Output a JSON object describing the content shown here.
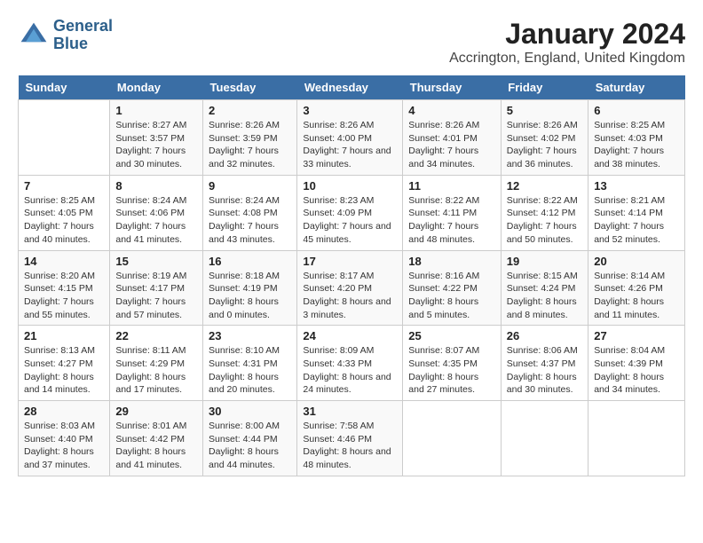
{
  "header": {
    "logo_line1": "General",
    "logo_line2": "Blue",
    "title": "January 2024",
    "subtitle": "Accrington, England, United Kingdom"
  },
  "calendar": {
    "days_of_week": [
      "Sunday",
      "Monday",
      "Tuesday",
      "Wednesday",
      "Thursday",
      "Friday",
      "Saturday"
    ],
    "weeks": [
      [
        {
          "day": "",
          "sunrise": "",
          "sunset": "",
          "daylight": ""
        },
        {
          "day": "1",
          "sunrise": "Sunrise: 8:27 AM",
          "sunset": "Sunset: 3:57 PM",
          "daylight": "Daylight: 7 hours and 30 minutes."
        },
        {
          "day": "2",
          "sunrise": "Sunrise: 8:26 AM",
          "sunset": "Sunset: 3:59 PM",
          "daylight": "Daylight: 7 hours and 32 minutes."
        },
        {
          "day": "3",
          "sunrise": "Sunrise: 8:26 AM",
          "sunset": "Sunset: 4:00 PM",
          "daylight": "Daylight: 7 hours and 33 minutes."
        },
        {
          "day": "4",
          "sunrise": "Sunrise: 8:26 AM",
          "sunset": "Sunset: 4:01 PM",
          "daylight": "Daylight: 7 hours and 34 minutes."
        },
        {
          "day": "5",
          "sunrise": "Sunrise: 8:26 AM",
          "sunset": "Sunset: 4:02 PM",
          "daylight": "Daylight: 7 hours and 36 minutes."
        },
        {
          "day": "6",
          "sunrise": "Sunrise: 8:25 AM",
          "sunset": "Sunset: 4:03 PM",
          "daylight": "Daylight: 7 hours and 38 minutes."
        }
      ],
      [
        {
          "day": "7",
          "sunrise": "Sunrise: 8:25 AM",
          "sunset": "Sunset: 4:05 PM",
          "daylight": "Daylight: 7 hours and 40 minutes."
        },
        {
          "day": "8",
          "sunrise": "Sunrise: 8:24 AM",
          "sunset": "Sunset: 4:06 PM",
          "daylight": "Daylight: 7 hours and 41 minutes."
        },
        {
          "day": "9",
          "sunrise": "Sunrise: 8:24 AM",
          "sunset": "Sunset: 4:08 PM",
          "daylight": "Daylight: 7 hours and 43 minutes."
        },
        {
          "day": "10",
          "sunrise": "Sunrise: 8:23 AM",
          "sunset": "Sunset: 4:09 PM",
          "daylight": "Daylight: 7 hours and 45 minutes."
        },
        {
          "day": "11",
          "sunrise": "Sunrise: 8:22 AM",
          "sunset": "Sunset: 4:11 PM",
          "daylight": "Daylight: 7 hours and 48 minutes."
        },
        {
          "day": "12",
          "sunrise": "Sunrise: 8:22 AM",
          "sunset": "Sunset: 4:12 PM",
          "daylight": "Daylight: 7 hours and 50 minutes."
        },
        {
          "day": "13",
          "sunrise": "Sunrise: 8:21 AM",
          "sunset": "Sunset: 4:14 PM",
          "daylight": "Daylight: 7 hours and 52 minutes."
        }
      ],
      [
        {
          "day": "14",
          "sunrise": "Sunrise: 8:20 AM",
          "sunset": "Sunset: 4:15 PM",
          "daylight": "Daylight: 7 hours and 55 minutes."
        },
        {
          "day": "15",
          "sunrise": "Sunrise: 8:19 AM",
          "sunset": "Sunset: 4:17 PM",
          "daylight": "Daylight: 7 hours and 57 minutes."
        },
        {
          "day": "16",
          "sunrise": "Sunrise: 8:18 AM",
          "sunset": "Sunset: 4:19 PM",
          "daylight": "Daylight: 8 hours and 0 minutes."
        },
        {
          "day": "17",
          "sunrise": "Sunrise: 8:17 AM",
          "sunset": "Sunset: 4:20 PM",
          "daylight": "Daylight: 8 hours and 3 minutes."
        },
        {
          "day": "18",
          "sunrise": "Sunrise: 8:16 AM",
          "sunset": "Sunset: 4:22 PM",
          "daylight": "Daylight: 8 hours and 5 minutes."
        },
        {
          "day": "19",
          "sunrise": "Sunrise: 8:15 AM",
          "sunset": "Sunset: 4:24 PM",
          "daylight": "Daylight: 8 hours and 8 minutes."
        },
        {
          "day": "20",
          "sunrise": "Sunrise: 8:14 AM",
          "sunset": "Sunset: 4:26 PM",
          "daylight": "Daylight: 8 hours and 11 minutes."
        }
      ],
      [
        {
          "day": "21",
          "sunrise": "Sunrise: 8:13 AM",
          "sunset": "Sunset: 4:27 PM",
          "daylight": "Daylight: 8 hours and 14 minutes."
        },
        {
          "day": "22",
          "sunrise": "Sunrise: 8:11 AM",
          "sunset": "Sunset: 4:29 PM",
          "daylight": "Daylight: 8 hours and 17 minutes."
        },
        {
          "day": "23",
          "sunrise": "Sunrise: 8:10 AM",
          "sunset": "Sunset: 4:31 PM",
          "daylight": "Daylight: 8 hours and 20 minutes."
        },
        {
          "day": "24",
          "sunrise": "Sunrise: 8:09 AM",
          "sunset": "Sunset: 4:33 PM",
          "daylight": "Daylight: 8 hours and 24 minutes."
        },
        {
          "day": "25",
          "sunrise": "Sunrise: 8:07 AM",
          "sunset": "Sunset: 4:35 PM",
          "daylight": "Daylight: 8 hours and 27 minutes."
        },
        {
          "day": "26",
          "sunrise": "Sunrise: 8:06 AM",
          "sunset": "Sunset: 4:37 PM",
          "daylight": "Daylight: 8 hours and 30 minutes."
        },
        {
          "day": "27",
          "sunrise": "Sunrise: 8:04 AM",
          "sunset": "Sunset: 4:39 PM",
          "daylight": "Daylight: 8 hours and 34 minutes."
        }
      ],
      [
        {
          "day": "28",
          "sunrise": "Sunrise: 8:03 AM",
          "sunset": "Sunset: 4:40 PM",
          "daylight": "Daylight: 8 hours and 37 minutes."
        },
        {
          "day": "29",
          "sunrise": "Sunrise: 8:01 AM",
          "sunset": "Sunset: 4:42 PM",
          "daylight": "Daylight: 8 hours and 41 minutes."
        },
        {
          "day": "30",
          "sunrise": "Sunrise: 8:00 AM",
          "sunset": "Sunset: 4:44 PM",
          "daylight": "Daylight: 8 hours and 44 minutes."
        },
        {
          "day": "31",
          "sunrise": "Sunrise: 7:58 AM",
          "sunset": "Sunset: 4:46 PM",
          "daylight": "Daylight: 8 hours and 48 minutes."
        },
        {
          "day": "",
          "sunrise": "",
          "sunset": "",
          "daylight": ""
        },
        {
          "day": "",
          "sunrise": "",
          "sunset": "",
          "daylight": ""
        },
        {
          "day": "",
          "sunrise": "",
          "sunset": "",
          "daylight": ""
        }
      ]
    ]
  }
}
